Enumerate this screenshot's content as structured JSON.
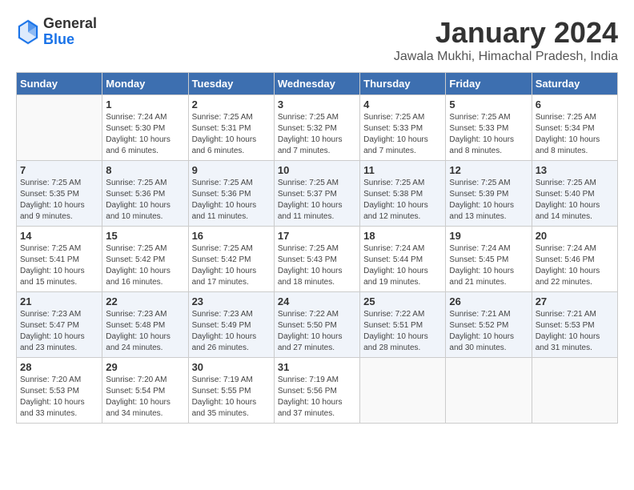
{
  "header": {
    "logo_general": "General",
    "logo_blue": "Blue",
    "month_title": "January 2024",
    "location": "Jawala Mukhi, Himachal Pradesh, India"
  },
  "weekdays": [
    "Sunday",
    "Monday",
    "Tuesday",
    "Wednesday",
    "Thursday",
    "Friday",
    "Saturday"
  ],
  "weeks": [
    {
      "shaded": false,
      "days": [
        {
          "num": "",
          "info": ""
        },
        {
          "num": "1",
          "info": "Sunrise: 7:24 AM\nSunset: 5:30 PM\nDaylight: 10 hours\nand 6 minutes."
        },
        {
          "num": "2",
          "info": "Sunrise: 7:25 AM\nSunset: 5:31 PM\nDaylight: 10 hours\nand 6 minutes."
        },
        {
          "num": "3",
          "info": "Sunrise: 7:25 AM\nSunset: 5:32 PM\nDaylight: 10 hours\nand 7 minutes."
        },
        {
          "num": "4",
          "info": "Sunrise: 7:25 AM\nSunset: 5:33 PM\nDaylight: 10 hours\nand 7 minutes."
        },
        {
          "num": "5",
          "info": "Sunrise: 7:25 AM\nSunset: 5:33 PM\nDaylight: 10 hours\nand 8 minutes."
        },
        {
          "num": "6",
          "info": "Sunrise: 7:25 AM\nSunset: 5:34 PM\nDaylight: 10 hours\nand 8 minutes."
        }
      ]
    },
    {
      "shaded": true,
      "days": [
        {
          "num": "7",
          "info": "Sunrise: 7:25 AM\nSunset: 5:35 PM\nDaylight: 10 hours\nand 9 minutes."
        },
        {
          "num": "8",
          "info": "Sunrise: 7:25 AM\nSunset: 5:36 PM\nDaylight: 10 hours\nand 10 minutes."
        },
        {
          "num": "9",
          "info": "Sunrise: 7:25 AM\nSunset: 5:36 PM\nDaylight: 10 hours\nand 11 minutes."
        },
        {
          "num": "10",
          "info": "Sunrise: 7:25 AM\nSunset: 5:37 PM\nDaylight: 10 hours\nand 11 minutes."
        },
        {
          "num": "11",
          "info": "Sunrise: 7:25 AM\nSunset: 5:38 PM\nDaylight: 10 hours\nand 12 minutes."
        },
        {
          "num": "12",
          "info": "Sunrise: 7:25 AM\nSunset: 5:39 PM\nDaylight: 10 hours\nand 13 minutes."
        },
        {
          "num": "13",
          "info": "Sunrise: 7:25 AM\nSunset: 5:40 PM\nDaylight: 10 hours\nand 14 minutes."
        }
      ]
    },
    {
      "shaded": false,
      "days": [
        {
          "num": "14",
          "info": "Sunrise: 7:25 AM\nSunset: 5:41 PM\nDaylight: 10 hours\nand 15 minutes."
        },
        {
          "num": "15",
          "info": "Sunrise: 7:25 AM\nSunset: 5:42 PM\nDaylight: 10 hours\nand 16 minutes."
        },
        {
          "num": "16",
          "info": "Sunrise: 7:25 AM\nSunset: 5:42 PM\nDaylight: 10 hours\nand 17 minutes."
        },
        {
          "num": "17",
          "info": "Sunrise: 7:25 AM\nSunset: 5:43 PM\nDaylight: 10 hours\nand 18 minutes."
        },
        {
          "num": "18",
          "info": "Sunrise: 7:24 AM\nSunset: 5:44 PM\nDaylight: 10 hours\nand 19 minutes."
        },
        {
          "num": "19",
          "info": "Sunrise: 7:24 AM\nSunset: 5:45 PM\nDaylight: 10 hours\nand 21 minutes."
        },
        {
          "num": "20",
          "info": "Sunrise: 7:24 AM\nSunset: 5:46 PM\nDaylight: 10 hours\nand 22 minutes."
        }
      ]
    },
    {
      "shaded": true,
      "days": [
        {
          "num": "21",
          "info": "Sunrise: 7:23 AM\nSunset: 5:47 PM\nDaylight: 10 hours\nand 23 minutes."
        },
        {
          "num": "22",
          "info": "Sunrise: 7:23 AM\nSunset: 5:48 PM\nDaylight: 10 hours\nand 24 minutes."
        },
        {
          "num": "23",
          "info": "Sunrise: 7:23 AM\nSunset: 5:49 PM\nDaylight: 10 hours\nand 26 minutes."
        },
        {
          "num": "24",
          "info": "Sunrise: 7:22 AM\nSunset: 5:50 PM\nDaylight: 10 hours\nand 27 minutes."
        },
        {
          "num": "25",
          "info": "Sunrise: 7:22 AM\nSunset: 5:51 PM\nDaylight: 10 hours\nand 28 minutes."
        },
        {
          "num": "26",
          "info": "Sunrise: 7:21 AM\nSunset: 5:52 PM\nDaylight: 10 hours\nand 30 minutes."
        },
        {
          "num": "27",
          "info": "Sunrise: 7:21 AM\nSunset: 5:53 PM\nDaylight: 10 hours\nand 31 minutes."
        }
      ]
    },
    {
      "shaded": false,
      "days": [
        {
          "num": "28",
          "info": "Sunrise: 7:20 AM\nSunset: 5:53 PM\nDaylight: 10 hours\nand 33 minutes."
        },
        {
          "num": "29",
          "info": "Sunrise: 7:20 AM\nSunset: 5:54 PM\nDaylight: 10 hours\nand 34 minutes."
        },
        {
          "num": "30",
          "info": "Sunrise: 7:19 AM\nSunset: 5:55 PM\nDaylight: 10 hours\nand 35 minutes."
        },
        {
          "num": "31",
          "info": "Sunrise: 7:19 AM\nSunset: 5:56 PM\nDaylight: 10 hours\nand 37 minutes."
        },
        {
          "num": "",
          "info": ""
        },
        {
          "num": "",
          "info": ""
        },
        {
          "num": "",
          "info": ""
        }
      ]
    }
  ]
}
